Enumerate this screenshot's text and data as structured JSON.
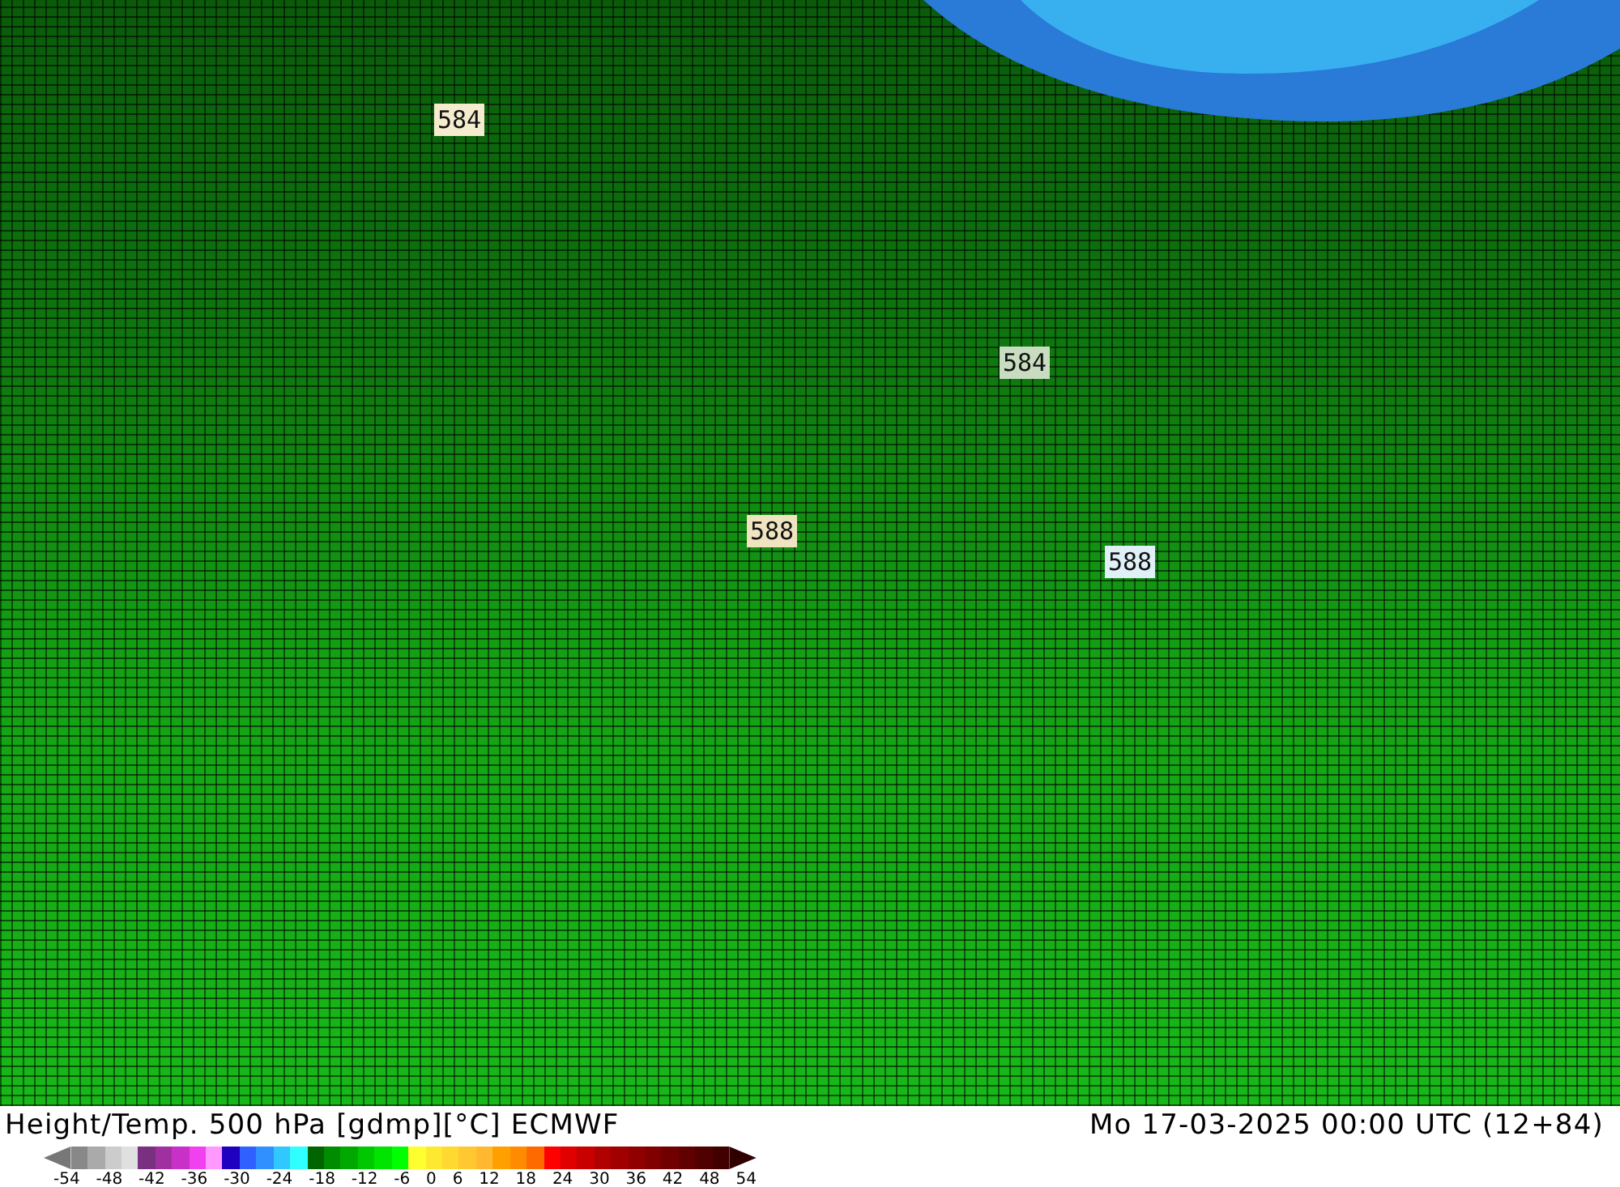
{
  "map": {
    "contour_labels": [
      {
        "text": "584",
        "color": "#f5ecd0"
      },
      {
        "text": "584",
        "color": "#c8dcc0"
      },
      {
        "text": "588",
        "color": "#f0e4c0"
      },
      {
        "text": "588",
        "color": "#e0f0f8"
      }
    ]
  },
  "footer": {
    "title": "Height/Temp. 500 hPa [gdmp][°C] ECMWF",
    "datetime": "Mo 17-03-2025 00:00 UTC (12+84)"
  },
  "legend": {
    "swatches": [
      {
        "color": "#777777"
      },
      {
        "color": "#888888"
      },
      {
        "color": "#aaaaaa"
      },
      {
        "color": "#cccccc"
      },
      {
        "color": "#e0e0e0"
      },
      {
        "color": "#7a3080"
      },
      {
        "color": "#a030a0"
      },
      {
        "color": "#c830c8"
      },
      {
        "color": "#f040f0"
      },
      {
        "color": "#ff99ff"
      },
      {
        "color": "#2000c0"
      },
      {
        "color": "#3060ff"
      },
      {
        "color": "#3090ff"
      },
      {
        "color": "#30c8ff"
      },
      {
        "color": "#30ffff"
      },
      {
        "color": "#006400"
      },
      {
        "color": "#008c00"
      },
      {
        "color": "#00a800"
      },
      {
        "color": "#00c800"
      },
      {
        "color": "#00e400"
      },
      {
        "color": "#00ff00"
      },
      {
        "color": "#ffff30"
      },
      {
        "color": "#ffe830"
      },
      {
        "color": "#ffd830"
      },
      {
        "color": "#ffc830"
      },
      {
        "color": "#ffb830"
      },
      {
        "color": "#ffa000"
      },
      {
        "color": "#ff8c00"
      },
      {
        "color": "#ff6a00"
      },
      {
        "color": "#ff0000"
      },
      {
        "color": "#e00000"
      },
      {
        "color": "#c80000"
      },
      {
        "color": "#b00000"
      },
      {
        "color": "#a00000"
      },
      {
        "color": "#900000"
      },
      {
        "color": "#800000"
      },
      {
        "color": "#700000"
      },
      {
        "color": "#600000"
      },
      {
        "color": "#500000"
      },
      {
        "color": "#400000"
      },
      {
        "color": "#300000"
      }
    ],
    "ticks": [
      "-54",
      "-48",
      "-42",
      "-36",
      "-30",
      "-24",
      "-18",
      "-12",
      "-6",
      "0",
      "6",
      "12",
      "18",
      "24",
      "30",
      "36",
      "42",
      "48",
      "54"
    ]
  }
}
